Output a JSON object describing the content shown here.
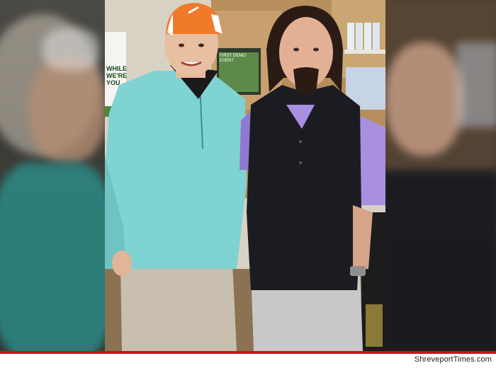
{
  "image": {
    "watermark": "ShreveportTimes.com",
    "background_poster_text": "WHILE WE'RE YOU",
    "screen_text": "FIRST DEMO EVENT",
    "colors": {
      "accent_bar": "#c4161c",
      "cap": "#f07a2a",
      "pullover": "#7fd3d2",
      "vest": "#1b1c22",
      "shirt": "#a98fe0",
      "pants_left": "#c9bfae",
      "pants_right": "#c8c8c8"
    }
  }
}
